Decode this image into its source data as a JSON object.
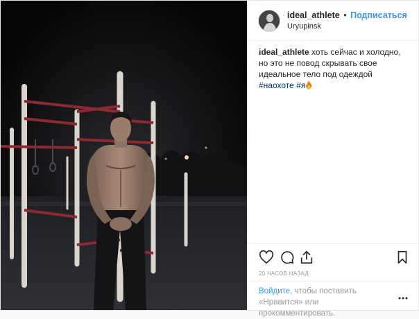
{
  "header": {
    "username": "ideal_athlete",
    "separator": "•",
    "follow_label": "Подписаться",
    "location": "Uryupinsk"
  },
  "caption": {
    "username": "ideal_athlete",
    "text": "хоть сейчас и холодно, но это не повод скрывать свое идеальное тело под одеждой",
    "hashtags": [
      "#наохоте",
      "#я"
    ],
    "emoji": "fire-icon"
  },
  "actions": {
    "like_icon": "heart-icon",
    "comment_icon": "comment-icon",
    "share_icon": "share-icon",
    "save_icon": "bookmark-icon"
  },
  "timestamp": "20 ЧАСОВ НАЗАД",
  "footer": {
    "login_label": "Войдите,",
    "rest_text": " чтобы поставить «Нравится» или прокомментировать.",
    "more_icon": "more-options-icon"
  },
  "colors": {
    "accent": "#3897f0",
    "hashtag": "#003569",
    "muted": "#999999"
  }
}
